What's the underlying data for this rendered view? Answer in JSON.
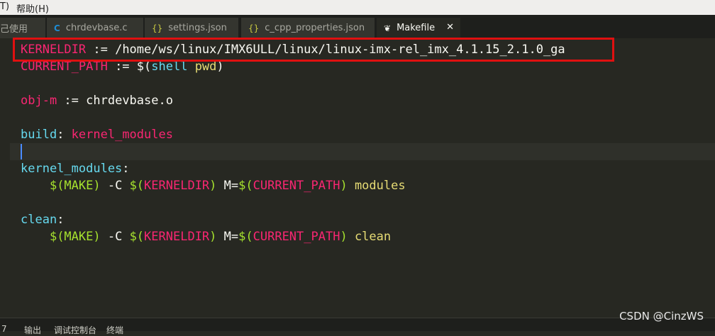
{
  "menubar": {
    "left_fragment": "T)",
    "help": "帮助(H)"
  },
  "tabs": {
    "partial": "己使用",
    "t1": "chrdevbase.c",
    "t2": "settings.json",
    "t3": "c_cpp_properties.json",
    "t4": "Makefile",
    "close": "✕",
    "c_icon": "C",
    "json_icon": "{}",
    "make_icon": "❦"
  },
  "code": {
    "l1_name": "KERNELDIR",
    "l1_op": " := ",
    "l1_val": "/home/ws/linux/IMX6ULL/linux/linux-imx-rel_imx_4.1.15_2.1.0_ga",
    "l2_name": "CURRENT_PATH",
    "l2_op": " := ",
    "l2_d1": "$(",
    "l2_fn": "shell",
    "l2_arg": " pwd",
    "l2_d2": ")",
    "l4_name": "obj-m",
    "l4_op": " := ",
    "l4_val": "chrdevbase.o",
    "l6_target": "build",
    "l6_colon": ": ",
    "l6_dep": "kernel_modules",
    "l9_target": "kernel_modules",
    "l9_colon": ":",
    "l10_ind": "    ",
    "l10_make": "$(MAKE)",
    "l10_c": " -C ",
    "l10_kd_d1": "$(",
    "l10_kd": "KERNELDIR",
    "l10_kd_d2": ")",
    "l10_m": " M=",
    "l10_cp_d1": "$(",
    "l10_cp": "CURRENT_PATH",
    "l10_cp_d2": ")",
    "l10_tail": " modules",
    "l12_target": "clean",
    "l12_colon": ":",
    "l13_ind": "    ",
    "l13_make": "$(MAKE)",
    "l13_c": " -C ",
    "l13_kd_d1": "$(",
    "l13_kd": "KERNELDIR",
    "l13_kd_d2": ")",
    "l13_m": " M=",
    "l13_cp_d1": "$(",
    "l13_cp": "CURRENT_PATH",
    "l13_cp_d2": ")",
    "l13_tail": " clean"
  },
  "statusbar": {
    "s0": "7",
    "s1": "输出",
    "s2": "调试控制台",
    "s3": "终端"
  },
  "watermark": "CSDN @CinzWS",
  "colors": {
    "editor_bg": "#272822",
    "keyword": "#f92672",
    "target": "#66d9ef",
    "var": "#a6e22e",
    "string": "#e6db74",
    "highlight_box": "#e01010"
  }
}
